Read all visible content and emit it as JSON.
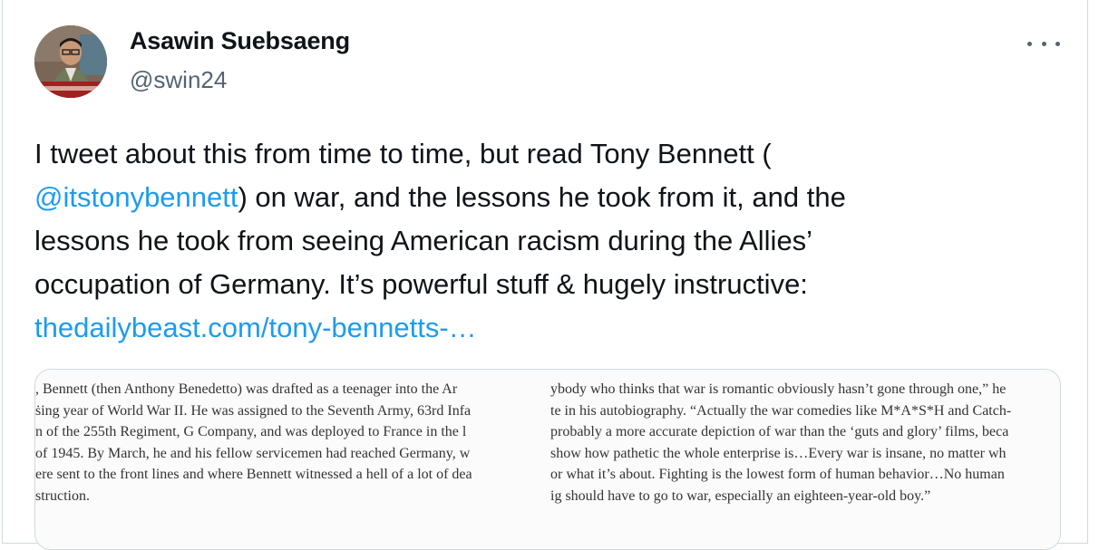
{
  "author": {
    "name": "Asawin Suebsaeng",
    "handle": "@swin24",
    "avatar_icon": "profile-photo"
  },
  "more_icon": "more-horizontal-icon",
  "tweet": {
    "lines": [
      [
        {
          "text": "I tweet about this from time to time, but read Tony Bennett (",
          "link": false
        }
      ],
      [
        {
          "text": "@itstonybennett",
          "link": true
        },
        {
          "text": ") on war, and the lessons he took from it, and the",
          "link": false
        }
      ],
      [
        {
          "text": "lessons he took from seeing American racism during the Allies’",
          "link": false
        }
      ],
      [
        {
          "text": "occupation of Germany. It’s powerful stuff & hugely instructive:",
          "link": false
        }
      ],
      [
        {
          "text": "thedailybeast.com/tony-bennetts-…",
          "link": true
        }
      ]
    ],
    "link_color": "#1d9bf0"
  },
  "media": {
    "left_column": [
      ", Bennett (then Anthony Benedetto) was drafted as a teenager into the Ar",
      "ṡing year of World War II. He was assigned to the Seventh Army, 63rd Infa",
      "n of the 255th Regiment, G Company, and was deployed to France in the l",
      "of 1945. By March, he and his fellow servicemen had reached Germany, w",
      "ere sent to the front lines and where Bennett witnessed a hell of a lot of dea",
      "struction."
    ],
    "right_column": [
      "ybody who thinks that war is romantic obviously hasn’t gone through one,” he",
      "te in his autobiography. “Actually the war comedies like M*A*S*H and Catch-",
      "probably a more accurate depiction of war than the ‘guts and glory’ films, beca",
      "show how pathetic the whole enterprise is…Every war is insane, no matter wh",
      "or what it’s about. Fighting is the lowest form of human behavior…No human",
      "ig should have to go to war, especially an eighteen-year-old boy.”"
    ]
  }
}
